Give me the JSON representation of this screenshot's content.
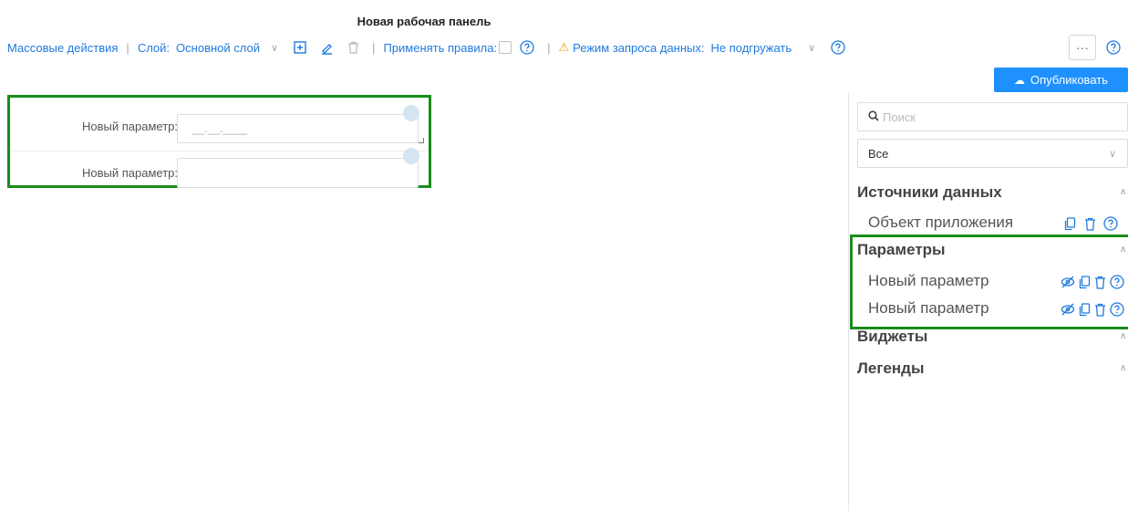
{
  "header": {
    "title": "Новая рабочая панель"
  },
  "toolbar": {
    "bulk_actions": "Массовые действия",
    "layer_label": "Слой:",
    "layer_value": "Основной слой",
    "apply_rules_label": "Применять правила:",
    "query_mode_label": "Режим запроса данных:",
    "query_mode_value": "Не подгружать",
    "more": "···"
  },
  "publish_button": "Опубликовать",
  "canvas": {
    "params": [
      {
        "label": "Новый параметр:",
        "value": "__.__.____"
      },
      {
        "label": "Новый параметр:",
        "value": ""
      }
    ]
  },
  "sidebar": {
    "search_placeholder": "Поиск",
    "filter_value": "Все",
    "sections": {
      "data_sources": {
        "title": "Источники данных",
        "items": [
          "Объект приложения"
        ]
      },
      "parameters": {
        "title": "Параметры",
        "items": [
          "Новый параметр",
          "Новый параметр"
        ]
      },
      "widgets": {
        "title": "Виджеты"
      },
      "legends": {
        "title": "Легенды"
      }
    }
  },
  "colors": {
    "accent": "#1e90ff",
    "highlight": "#1a8c1a",
    "warning": "#f0a000"
  }
}
